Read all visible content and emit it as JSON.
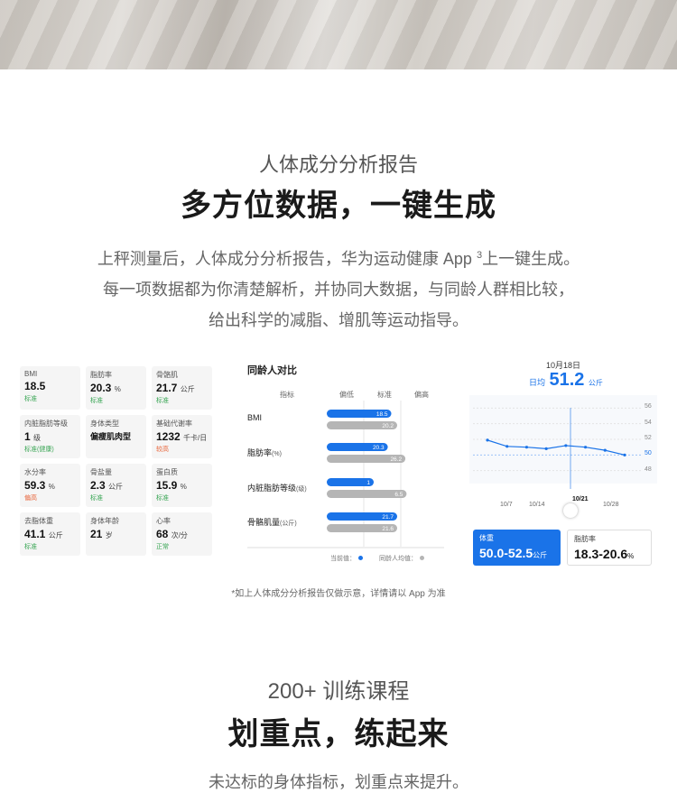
{
  "section1": {
    "subtitle": "人体成分分析报告",
    "title": "多方位数据，一键生成",
    "desc_line1_pre": "上秤测量后，人体成分分析报告，华为运动健康 App",
    "desc_line1_sup": "3",
    "desc_line1_post": "上一键生成。",
    "desc_line2": "每一项数据都为你清楚解析，并协同大数据，与同龄人群相比较，",
    "desc_line3": "给出科学的减脂、增肌等运动指导。"
  },
  "metrics": [
    {
      "label": "BMI",
      "value": "18.5",
      "unit": "",
      "status": "标准",
      "status_color": "#3aa655"
    },
    {
      "label": "脂肪率",
      "value": "20.3",
      "unit": "%",
      "status": "标准",
      "status_color": "#3aa655"
    },
    {
      "label": "骨骼肌",
      "value": "21.7",
      "unit": "公斤",
      "status": "标准",
      "status_color": "#3aa655"
    },
    {
      "label": "内脏脂肪等级",
      "value": "1",
      "unit": "级",
      "status": "标准(健康)",
      "status_color": "#3aa655"
    },
    {
      "label": "身体类型",
      "value": "偏瘦肌肉型",
      "unit": "",
      "status": "",
      "status_color": "#3aa655"
    },
    {
      "label": "基础代谢率",
      "value": "1232",
      "unit": "千卡/日",
      "status": "较高",
      "status_color": "#e8643a"
    },
    {
      "label": "水分率",
      "value": "59.3",
      "unit": "%",
      "status": "偏高",
      "status_color": "#e8643a"
    },
    {
      "label": "骨盐量",
      "value": "2.3",
      "unit": "公斤",
      "status": "标准",
      "status_color": "#3aa655"
    },
    {
      "label": "蛋白质",
      "value": "15.9",
      "unit": "%",
      "status": "标准",
      "status_color": "#3aa655"
    },
    {
      "label": "去脂体重",
      "value": "41.1",
      "unit": "公斤",
      "status": "标准",
      "status_color": "#3aa655"
    },
    {
      "label": "身体年龄",
      "value": "21",
      "unit": "岁",
      "status": "",
      "status_color": "#3aa655"
    },
    {
      "label": "心率",
      "value": "68",
      "unit": "次/分",
      "status": "正常",
      "status_color": "#3aa655"
    }
  ],
  "compare": {
    "title": "同龄人对比",
    "headers": [
      "指标",
      "偏低",
      "标准",
      "偏高"
    ],
    "legend_current": "当前值：",
    "legend_peer": "同龄人均值：",
    "current_color": "#1a73e8",
    "peer_color": "#b5b5b5"
  },
  "chart_data": [
    {
      "type": "bar",
      "title": "同龄人对比",
      "categories": [
        "BMI",
        "脂肪率",
        "内脏脂肪等级",
        "骨骼肌量"
      ],
      "category_units": [
        "",
        "(%)",
        "(级)",
        "(公斤)"
      ],
      "series": [
        {
          "name": "当前值",
          "values": [
            18.5,
            20.3,
            1,
            21.7
          ],
          "fill": [
            0.55,
            0.52,
            0.4,
            0.6
          ]
        },
        {
          "name": "同龄人均值",
          "values": [
            20.2,
            26.2,
            6.5,
            21.6
          ],
          "fill": [
            0.6,
            0.67,
            0.68,
            0.6
          ]
        }
      ]
    },
    {
      "type": "line",
      "title": "",
      "x_ticks": [
        "10/7",
        "10/14",
        "10/21",
        "10/28"
      ],
      "selected_x": "10/21",
      "y_ticks": [
        56,
        54,
        52,
        50,
        48
      ],
      "highlight_y": 50,
      "ylim": [
        47.5,
        56.5
      ],
      "points": [
        51.9,
        51.1,
        51.0,
        50.8,
        51.2,
        51.0,
        50.6,
        50.0
      ]
    }
  ],
  "trend": {
    "date": "10月18日",
    "avg_label": "日均",
    "avg_value": "51.2",
    "avg_unit": "公斤",
    "weight_label": "体重",
    "weight_value": "50.0-52.5",
    "weight_unit": "公斤",
    "fat_label": "脂肪率",
    "fat_value": "18.3-20.6",
    "fat_unit": "%"
  },
  "disclaimer": "*如上人体成分分析报告仅做示意，详情请以 App 为准",
  "section2": {
    "subtitle": "200+ 训练课程",
    "title": "划重点，练起来",
    "desc_line1": "未达标的身体指标，划重点来提升。"
  }
}
